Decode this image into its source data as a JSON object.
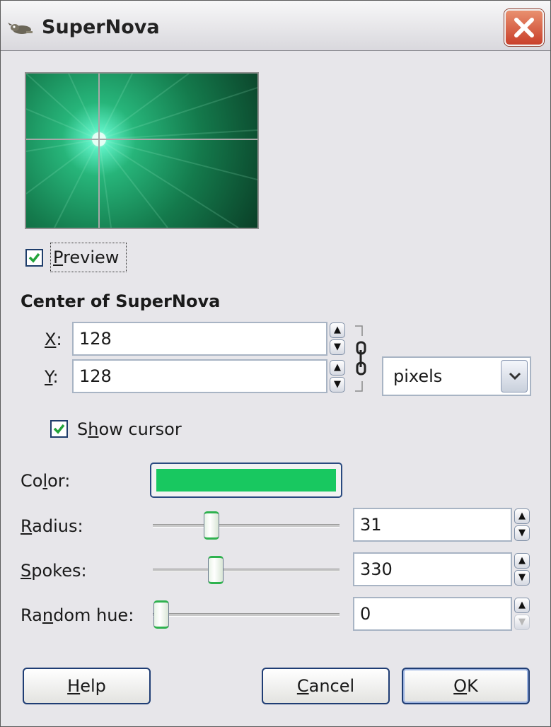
{
  "window": {
    "title": "SuperNova",
    "app_icon": "gimp-wilber-icon",
    "close_icon": "close-x-icon"
  },
  "preview": {
    "checkbox_checked": true,
    "label_underlined": "P",
    "label_rest": "review"
  },
  "center": {
    "section_title": "Center of SuperNova",
    "x_label_underlined": "X",
    "x_label_rest": ":",
    "x_value": "128",
    "y_label_underlined": "Y",
    "y_label_rest": ":",
    "y_value": "128",
    "units": "pixels",
    "chain_icon": "chain-link-icon"
  },
  "show_cursor": {
    "checked": true,
    "label_before": "S",
    "label_underlined": "h",
    "label_after": "ow cursor"
  },
  "color": {
    "label_before": "Co",
    "label_underlined": "l",
    "label_after": "or:",
    "value": "#18c860"
  },
  "radius": {
    "label_underlined": "R",
    "label_rest": "adius:",
    "value": "31",
    "min": 1,
    "max": 100
  },
  "spokes": {
    "label_underlined": "S",
    "label_rest": "pokes:",
    "value": "330",
    "min": 1,
    "max": 1024
  },
  "random_hue": {
    "label_before": "Ra",
    "label_underlined": "n",
    "label_after": "dom hue:",
    "value": "0",
    "min": 0,
    "max": 360
  },
  "buttons": {
    "help_underlined": "H",
    "help_rest": "elp",
    "cancel_underlined": "C",
    "cancel_rest": "ancel",
    "ok_underlined": "O",
    "ok_rest": "K"
  }
}
